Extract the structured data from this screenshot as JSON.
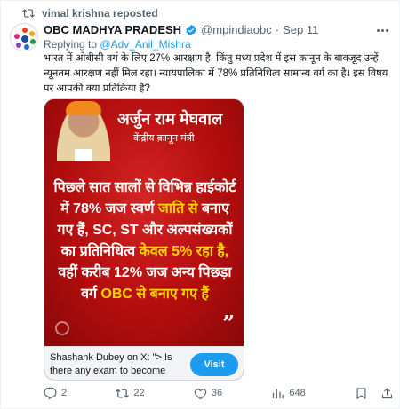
{
  "repost": {
    "text": "vimal krishna reposted",
    "icon": "repost-icon"
  },
  "author": {
    "name": "OBC MADHYA PRADESH",
    "handle": "@mpindiaobc",
    "separator": "·",
    "date": "Sep 11",
    "avatar": "obc-logo"
  },
  "reply": {
    "prefix": "Replying to",
    "to": "@Adv_Anil_Mishra"
  },
  "tweet_text": "भारत में ओबीसी वर्ग के लिए 27% आरक्षण है, किंतु मध्य प्रदेश में इस कानून के बावजूद उन्हें न्यूनतम आरक्षण नहीं मिल रहा। न्यायपालिका में 78% प्रतिनिधित्व सामान्य वर्ग का है। इस विषय पर आपकी क्या प्रतिक्रिया है?",
  "poster": {
    "person_name": "अर्जुन राम मेघवाल",
    "person_title": "केंद्रीय क़ानून मंत्री",
    "quote": {
      "p1": "पिछले सात सालों से विभिन्न हाईकोर्ट में 78% जज स्वर्ण",
      "h1": "जाति से",
      "p2": "बनाए गए हैं, SC, ST और अल्पसंख्यकों का प्रतिनिधित्व",
      "h2": "केवल 5% रहा है,",
      "p3": "वहीं करीब 12% जज अन्य पिछड़ा वर्ग",
      "h3": "OBC से बनाए गए हैं"
    },
    "quote_mark": "”"
  },
  "card": {
    "text": "Shashank Dubey on X: \"> Is there any exam to become an…",
    "button": "Visit"
  },
  "actions": {
    "replies": "2",
    "reposts": "22",
    "likes": "36",
    "views": "648"
  },
  "colors": {
    "link": "#1d9bf0",
    "muted": "#536471",
    "poster_red": "#b80f0f",
    "poster_yellow": "#ffd400"
  }
}
